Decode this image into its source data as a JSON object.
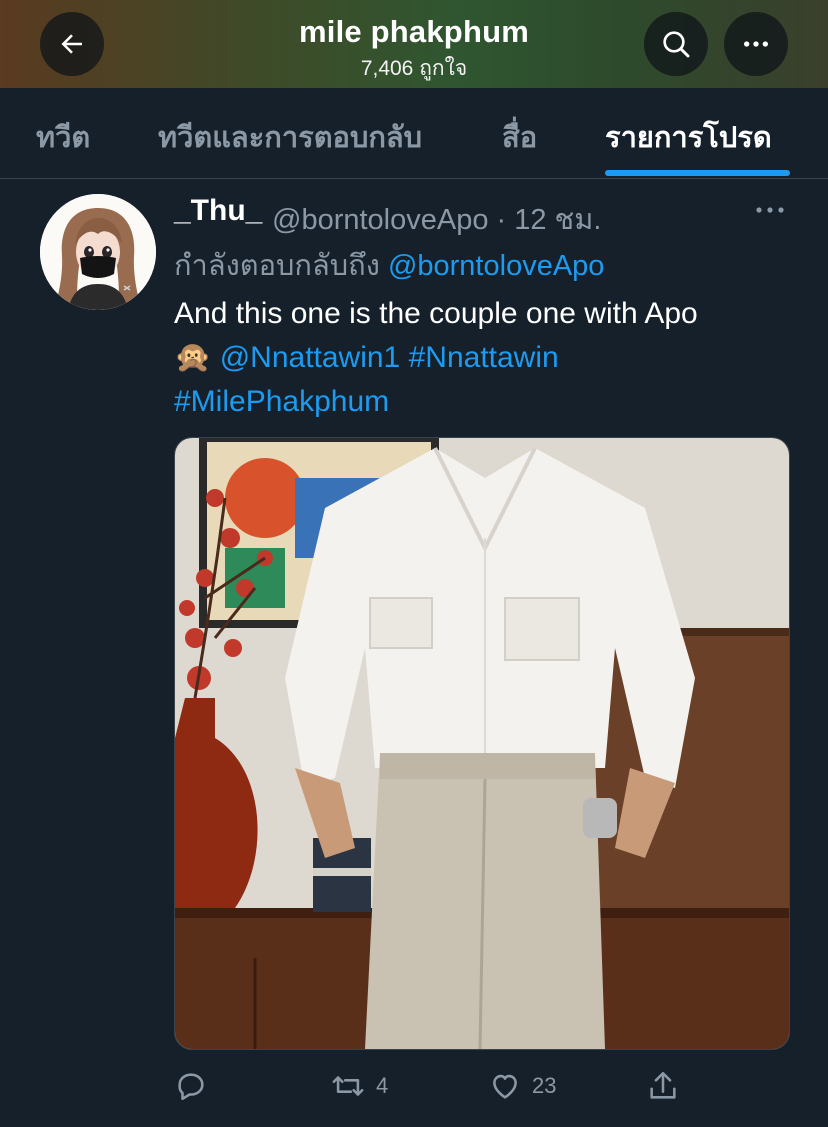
{
  "header": {
    "title": "mile phakphum",
    "subtitle": "7,406 ถูกใจ",
    "back_icon": "arrow-left-icon",
    "search_icon": "search-icon",
    "more_icon": "more-horizontal-icon"
  },
  "tabs": [
    {
      "label": "ทวีต",
      "active": false
    },
    {
      "label": "ทวีตและการตอบกลับ",
      "active": false
    },
    {
      "label": "สื่อ",
      "active": false
    },
    {
      "label": "รายการโปรด",
      "active": true
    }
  ],
  "tweet": {
    "display_name": "_Thu_",
    "handle_time": "@borntoloveApo · 12 ชม.",
    "reply_prefix": "กำลังตอบกลับถึง",
    "reply_mention": "@borntoloveApo",
    "text_line1": "And this one is the couple one with Apo",
    "emoji": "🙊",
    "mention1": "@Nnattawin1",
    "hashtag1": "#Nnattawin",
    "hashtag2": "#MilePhakphum",
    "actions": {
      "reply_icon": "reply-icon",
      "retweet_icon": "retweet-icon",
      "retweet_count": "4",
      "like_icon": "heart-icon",
      "like_count": "23",
      "share_icon": "share-icon"
    }
  },
  "colors": {
    "background": "#15202b",
    "accent": "#1d9bf0",
    "muted": "#8b98a5",
    "divider": "#38444d"
  }
}
